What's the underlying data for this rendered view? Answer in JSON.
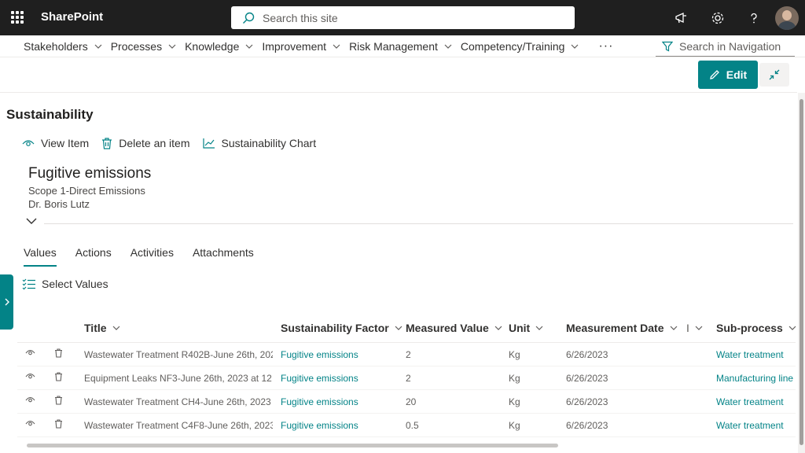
{
  "header": {
    "app_name": "SharePoint",
    "search_placeholder": "Search this site"
  },
  "nav": {
    "items": [
      {
        "label": "Stakeholders"
      },
      {
        "label": "Processes"
      },
      {
        "label": "Knowledge"
      },
      {
        "label": "Improvement"
      },
      {
        "label": "Risk Management"
      },
      {
        "label": "Competency/Training"
      }
    ],
    "more": "···",
    "search_placeholder": "Search in Navigation"
  },
  "toolbar": {
    "edit_label": "Edit"
  },
  "page": {
    "title": "Sustainability"
  },
  "commands": {
    "view_item": "View Item",
    "delete_item": "Delete an item",
    "chart": "Sustainability Chart"
  },
  "item": {
    "title": "Fugitive emissions",
    "scope": "Scope 1-Direct Emissions",
    "owner": "Dr. Boris Lutz"
  },
  "tabs": [
    {
      "label": "Values",
      "active": true
    },
    {
      "label": "Actions"
    },
    {
      "label": "Activities"
    },
    {
      "label": "Attachments"
    }
  ],
  "select_values_label": "Select Values",
  "grid": {
    "columns": {
      "title": "Title",
      "factor": "Sustainability Factor",
      "measured": "Measured Value",
      "unit": "Unit",
      "date": "Measurement Date",
      "trunc": "I",
      "subprocess": "Sub-process"
    },
    "rows": [
      {
        "title": "Wastewater Treatment R402B-June 26th, 202...",
        "factor": "Fugitive emissions",
        "measured": "2",
        "unit": "Kg",
        "date": "6/26/2023",
        "subprocess": "Water treatment"
      },
      {
        "title": "Equipment Leaks NF3-June 26th, 2023 at 12:...",
        "factor": "Fugitive emissions",
        "measured": "2",
        "unit": "Kg",
        "date": "6/26/2023",
        "subprocess": "Manufacturing line"
      },
      {
        "title": "Wastewater Treatment CH4-June 26th, 2023 ...",
        "factor": "Fugitive emissions",
        "measured": "20",
        "unit": "Kg",
        "date": "6/26/2023",
        "subprocess": "Water treatment"
      },
      {
        "title": "Wastewater Treatment C4F8-June 26th, 2023 ...",
        "factor": "Fugitive emissions",
        "measured": "0.5",
        "unit": "Kg",
        "date": "6/26/2023",
        "subprocess": "Water treatment"
      }
    ]
  },
  "colors": {
    "accent": "#038387",
    "topbar": "#1f1f1f"
  }
}
